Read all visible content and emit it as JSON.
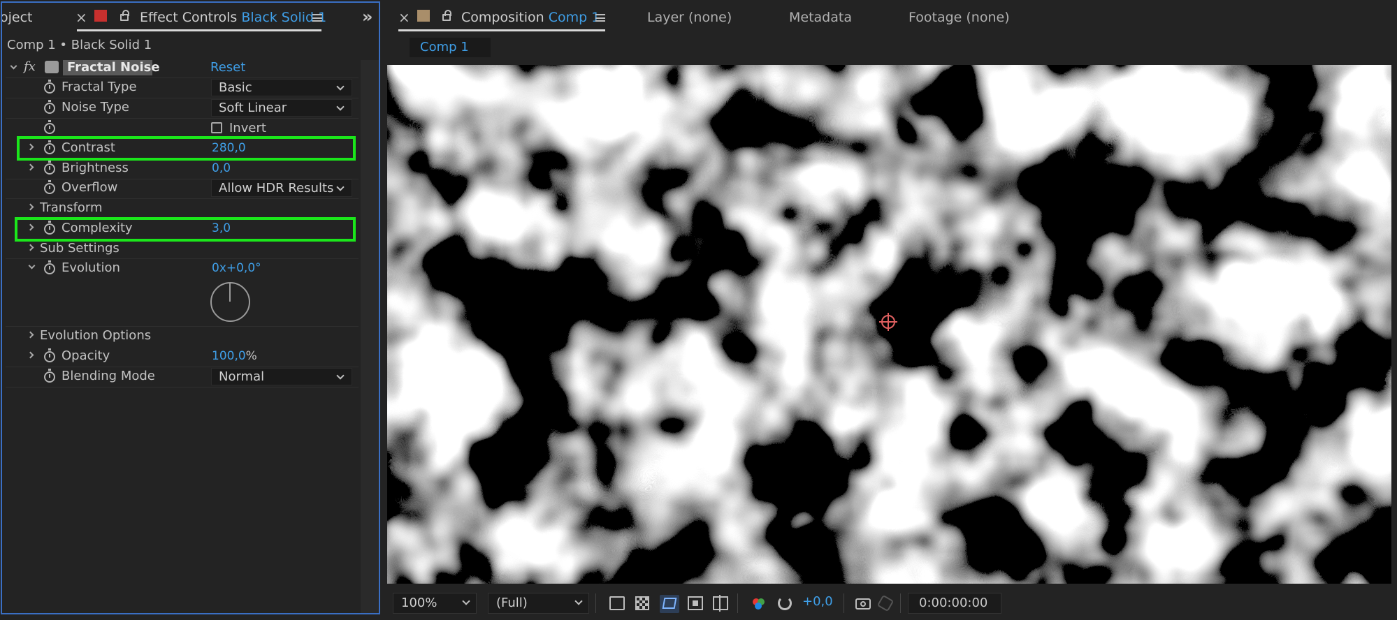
{
  "left_panel": {
    "project_tab": "oject",
    "effect_controls_tab": "Effect Controls",
    "effect_controls_target": "Black Solid 1",
    "breadcrumb": "Comp 1 • Black Solid 1",
    "effect": {
      "fx_label": "fx",
      "name": "Fractal Noise",
      "reset_label": "Reset"
    },
    "properties": {
      "fractal_type": {
        "label": "Fractal Type",
        "value": "Basic"
      },
      "noise_type": {
        "label": "Noise Type",
        "value": "Soft Linear"
      },
      "invert": {
        "label": "Invert",
        "checked": false
      },
      "contrast": {
        "label": "Contrast",
        "value": "280,0"
      },
      "brightness": {
        "label": "Brightness",
        "value": "0,0"
      },
      "overflow": {
        "label": "Overflow",
        "value": "Allow HDR Results"
      },
      "transform": {
        "label": "Transform"
      },
      "complexity": {
        "label": "Complexity",
        "value": "3,0"
      },
      "sub_settings": {
        "label": "Sub Settings"
      },
      "evolution": {
        "label": "Evolution",
        "value": "0x+0,0°"
      },
      "evolution_options": {
        "label": "Evolution Options"
      },
      "opacity": {
        "label": "Opacity",
        "value": "100,0",
        "unit": "%"
      },
      "blending_mode": {
        "label": "Blending Mode",
        "value": "Normal"
      }
    },
    "highlight_color": "#1be61b"
  },
  "right_panel": {
    "composition_tab": "Composition",
    "composition_name": "Comp 1",
    "layer_tab": "Layer (none)",
    "metadata_tab": "Metadata",
    "footage_tab": "Footage (none)",
    "comp_subtab": "Comp 1",
    "bottom_bar": {
      "zoom": "100%",
      "resolution": "(Full)",
      "exposure": "+0,0",
      "timecode": "0:00:00:00"
    }
  },
  "accent_color": "#3f9fe8"
}
